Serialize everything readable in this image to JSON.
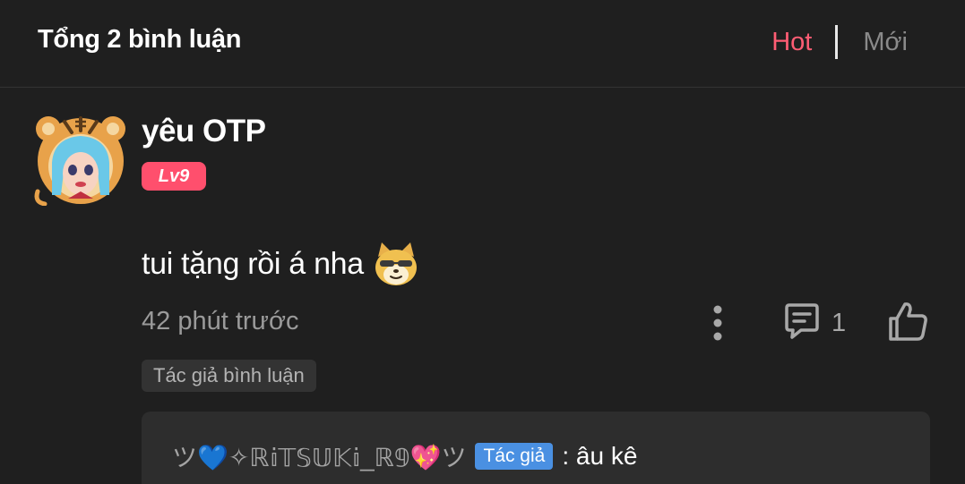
{
  "header": {
    "total_label": "Tổng 2 bình luận",
    "sort_hot": "Hot",
    "sort_new": "Mới"
  },
  "comment": {
    "username": "yêu OTP",
    "level": "Lv9",
    "text": "tui tặng rồi á nha",
    "time": "42 phút trước",
    "reply_count": "1",
    "author_tag": "Tác giả bình luận"
  },
  "reply": {
    "name": "ツ💙✧ℝ𝕚𝕋𝕊𝕌𝕂𝕚_ℝ𝟡💖ツ",
    "author_badge": "Tác giả",
    "text": ": âu kê"
  },
  "icons": {
    "avatar": "tiger-hood-avatar-icon",
    "emoji": "doge-sunglasses-emoji-icon",
    "more": "more-vertical-icon",
    "reply": "comment-icon",
    "like": "thumbs-up-icon"
  },
  "colors": {
    "background": "#1f1f1f",
    "accent_hot": "#ff5d74",
    "level_badge": "#ff4f6d",
    "author_badge": "#4a90e2"
  }
}
